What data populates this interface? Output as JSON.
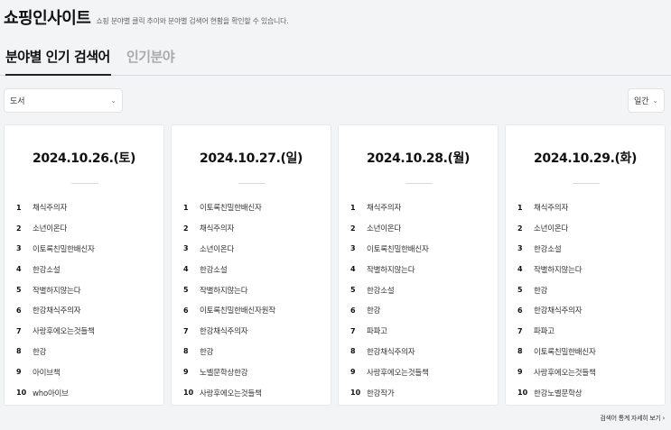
{
  "header": {
    "title": "쇼핑인사이트",
    "subtitle": "쇼핑 분야별 클릭 추이와 분야별 검색어 현황을 확인할 수 있습니다."
  },
  "tabs": [
    {
      "label": "분야별 인기 검색어",
      "active": true
    },
    {
      "label": "인기분야",
      "active": false
    }
  ],
  "filters": {
    "category": "도서",
    "period": "일간"
  },
  "days": [
    {
      "date": "2024.10.26.(토)",
      "ranks": [
        {
          "rank": "1",
          "keyword": "채식주의자"
        },
        {
          "rank": "2",
          "keyword": "소년이온다"
        },
        {
          "rank": "3",
          "keyword": "이토록친밀한배신자"
        },
        {
          "rank": "4",
          "keyword": "한강소설"
        },
        {
          "rank": "5",
          "keyword": "작별하지않는다"
        },
        {
          "rank": "6",
          "keyword": "한강채식주의자"
        },
        {
          "rank": "7",
          "keyword": "사랑후에오는것들책"
        },
        {
          "rank": "8",
          "keyword": "한강"
        },
        {
          "rank": "9",
          "keyword": "아이브책"
        },
        {
          "rank": "10",
          "keyword": "who아이브"
        }
      ]
    },
    {
      "date": "2024.10.27.(일)",
      "ranks": [
        {
          "rank": "1",
          "keyword": "이토록친밀한배신자"
        },
        {
          "rank": "2",
          "keyword": "채식주의자"
        },
        {
          "rank": "3",
          "keyword": "소년이온다"
        },
        {
          "rank": "4",
          "keyword": "한강소설"
        },
        {
          "rank": "5",
          "keyword": "작별하지않는다"
        },
        {
          "rank": "6",
          "keyword": "이토록친밀한배신자원작"
        },
        {
          "rank": "7",
          "keyword": "한강채식주의자"
        },
        {
          "rank": "8",
          "keyword": "한강"
        },
        {
          "rank": "9",
          "keyword": "노벨문학상한강"
        },
        {
          "rank": "10",
          "keyword": "사랑후에오는것들책"
        }
      ]
    },
    {
      "date": "2024.10.28.(월)",
      "ranks": [
        {
          "rank": "1",
          "keyword": "채식주의자"
        },
        {
          "rank": "2",
          "keyword": "소년이온다"
        },
        {
          "rank": "3",
          "keyword": "이토록친밀한배신자"
        },
        {
          "rank": "4",
          "keyword": "작별하지않는다"
        },
        {
          "rank": "5",
          "keyword": "한강소설"
        },
        {
          "rank": "6",
          "keyword": "한강"
        },
        {
          "rank": "7",
          "keyword": "파파고"
        },
        {
          "rank": "8",
          "keyword": "한강채식주의자"
        },
        {
          "rank": "9",
          "keyword": "사랑후에오는것들책"
        },
        {
          "rank": "10",
          "keyword": "한강작가"
        }
      ]
    },
    {
      "date": "2024.10.29.(화)",
      "ranks": [
        {
          "rank": "1",
          "keyword": "채식주의자"
        },
        {
          "rank": "2",
          "keyword": "소년이온다"
        },
        {
          "rank": "3",
          "keyword": "한강소설"
        },
        {
          "rank": "4",
          "keyword": "작별하지않는다"
        },
        {
          "rank": "5",
          "keyword": "한강"
        },
        {
          "rank": "6",
          "keyword": "한강채식주의자"
        },
        {
          "rank": "7",
          "keyword": "파파고"
        },
        {
          "rank": "8",
          "keyword": "이토록친밀한배신자"
        },
        {
          "rank": "9",
          "keyword": "사랑후에오는것들책"
        },
        {
          "rank": "10",
          "keyword": "한강노벨문학상"
        }
      ]
    }
  ],
  "footer": {
    "more_link": "검색어 통계 자세히 보기",
    "more_icon": "chevron-right-icon"
  }
}
